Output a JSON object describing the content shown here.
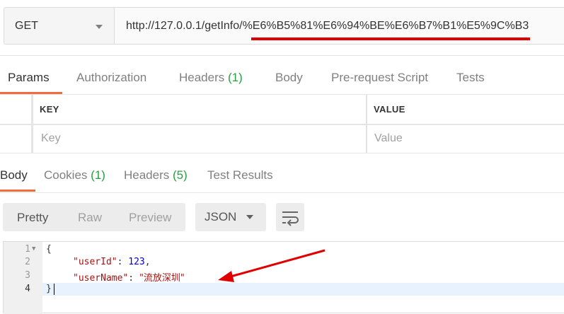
{
  "request": {
    "method": "GET",
    "url": "http://127.0.0.1/getInfo/%E6%B5%81%E6%94%BE%E6%B7%B1%E5%9C%B3"
  },
  "request_tabs": [
    {
      "label": "Params",
      "count": ""
    },
    {
      "label": "Authorization",
      "count": ""
    },
    {
      "label": "Headers",
      "count": "(1)"
    },
    {
      "label": "Body",
      "count": ""
    },
    {
      "label": "Pre-request Script",
      "count": ""
    },
    {
      "label": "Tests",
      "count": ""
    }
  ],
  "params_table": {
    "columns": [
      "KEY",
      "VALUE"
    ],
    "placeholders": {
      "key": "Key",
      "value": "Value"
    }
  },
  "response_tabs": [
    {
      "label": "Body",
      "count": ""
    },
    {
      "label": "Cookies",
      "count": "(1)"
    },
    {
      "label": "Headers",
      "count": "(5)"
    },
    {
      "label": "Test Results",
      "count": ""
    }
  ],
  "view_modes": [
    "Pretty",
    "Raw",
    "Preview"
  ],
  "language": "JSON",
  "code": {
    "line_numbers": [
      "1",
      "2",
      "3",
      "4"
    ],
    "lines": [
      {
        "text": "{"
      },
      {
        "key": "\"userId\"",
        "sep": ": ",
        "value": "123",
        "tail": ","
      },
      {
        "key": "\"userName\"",
        "sep": ": ",
        "value": "\"流放深圳\"",
        "tail": ""
      },
      {
        "text": "}"
      }
    ]
  },
  "colors": {
    "accent_underline": "#f26b3a",
    "count_green": "#26a042",
    "annotation_red": "#e00000"
  },
  "icons": [
    "chevron-down-icon",
    "wrap-lines-icon",
    "fold-arrow-icon"
  ]
}
